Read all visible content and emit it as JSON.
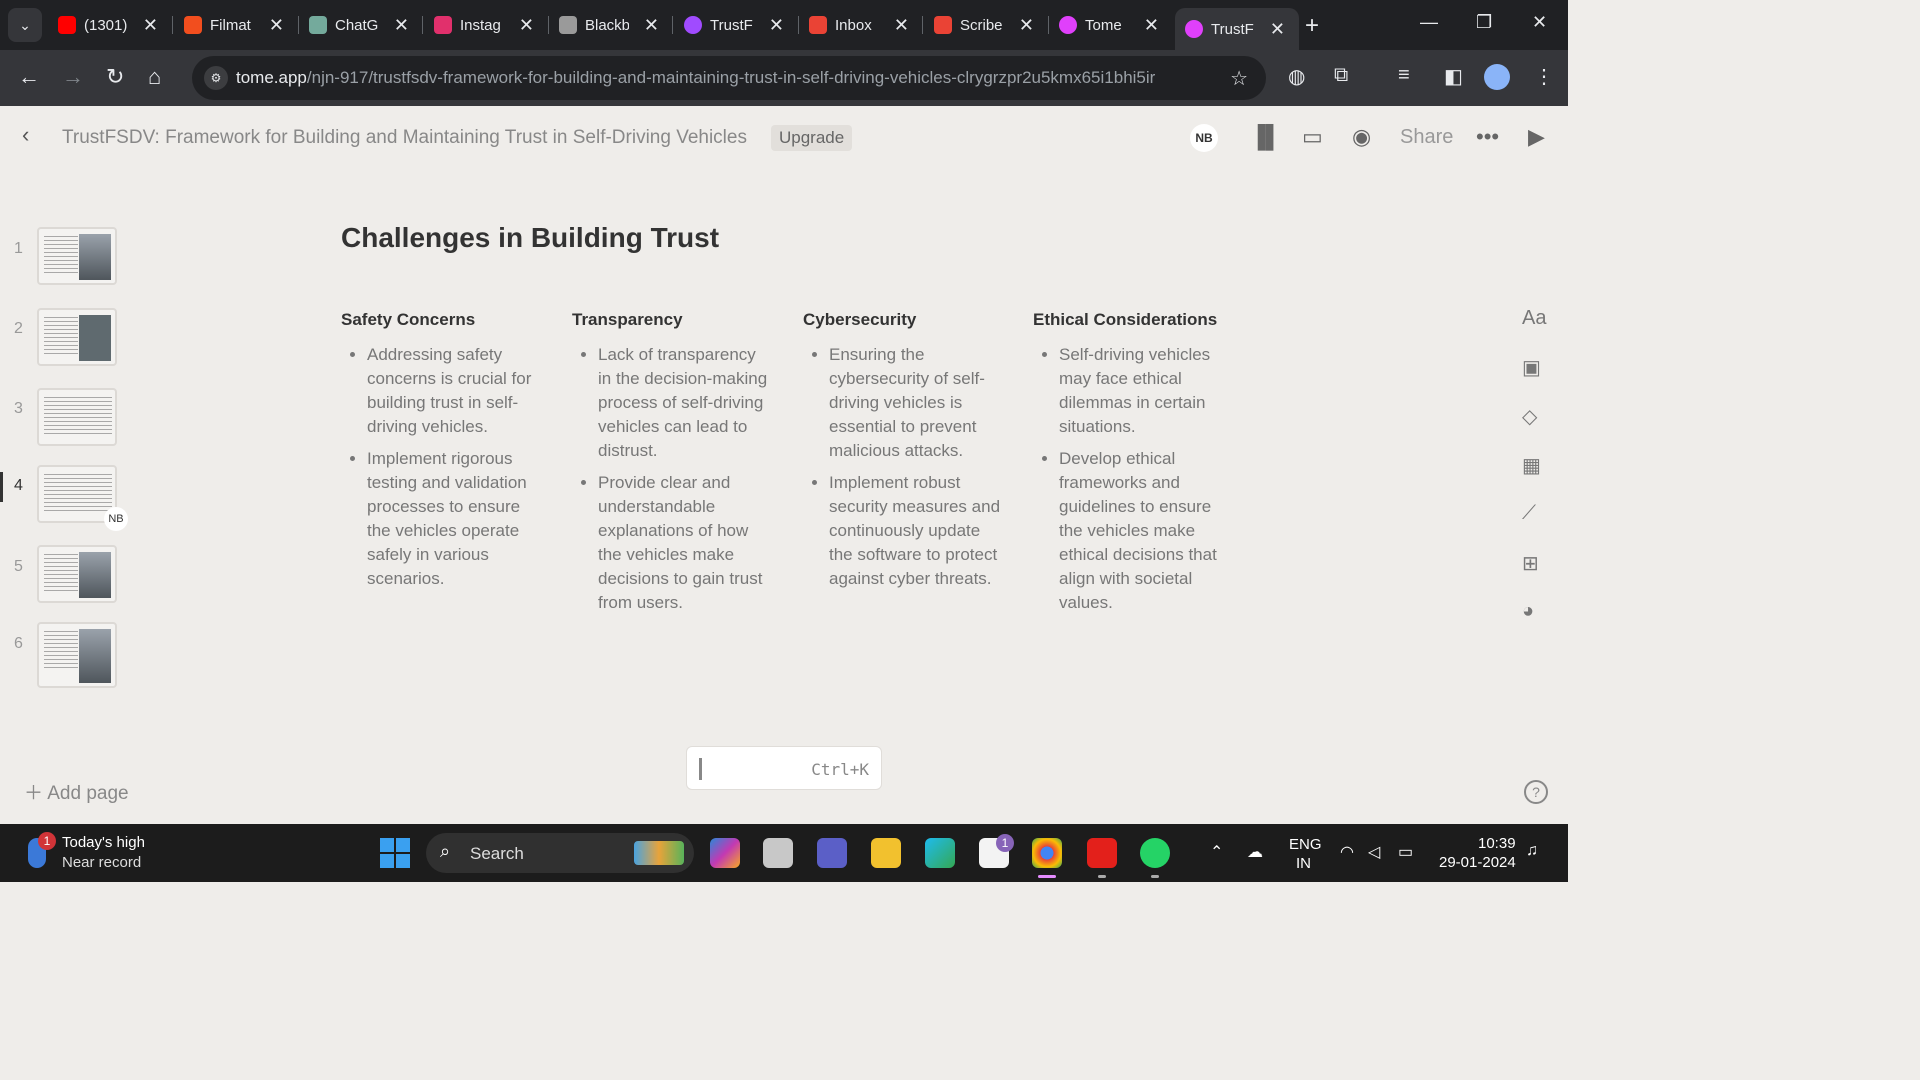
{
  "browser": {
    "tabs": [
      {
        "title": "(1301)",
        "icon": "youtube-icon",
        "color": "#ff0000"
      },
      {
        "title": "Filmat",
        "icon": "figma-icon",
        "color": "#f24e1e"
      },
      {
        "title": "ChatG",
        "icon": "chatgpt-icon",
        "color": "#74aa9c"
      },
      {
        "title": "Instag",
        "icon": "instagram-icon",
        "color": "#e1306c"
      },
      {
        "title": "Blackb",
        "icon": "blackbox-icon",
        "color": "#9a9a9a"
      },
      {
        "title": "TrustF",
        "icon": "gemini-icon",
        "color": "#a04bff"
      },
      {
        "title": "Inbox",
        "icon": "gmail-icon",
        "color": "#ea4335"
      },
      {
        "title": "Scribe",
        "icon": "gmail-icon",
        "color": "#ea4335"
      },
      {
        "title": "Tome",
        "icon": "tome-icon",
        "color": "#e040fb"
      },
      {
        "title": "TrustF",
        "icon": "tome-icon",
        "color": "#e040fb"
      }
    ],
    "url_host": "tome.app",
    "url_path": "/njn-917/trustfsdv-framework-for-building-and-maintaining-trust-in-self-driving-vehicles-clrygrzpr2u5kmx65i1bhi5ir"
  },
  "header": {
    "title": "TrustFSDV: Framework for Building and Maintaining Trust in Self-Driving Vehicles",
    "upgrade_label": "Upgrade",
    "avatar_initials": "NB",
    "share_label": "Share"
  },
  "sidebar": {
    "pages": [
      "1",
      "2",
      "3",
      "4",
      "5",
      "6"
    ],
    "active_page": "4",
    "badge": "NB",
    "add_page_label": "Add page"
  },
  "slide": {
    "title": "Challenges in Building Trust",
    "columns": [
      {
        "heading": "Safety Concerns",
        "bullets": [
          "Addressing safety concerns is crucial for building trust in self-driving vehicles.",
          "Implement rigorous testing and validation processes to ensure the vehicles operate safely in various scenarios."
        ]
      },
      {
        "heading": "Transparency",
        "bullets": [
          "Lack of transparency in the decision-making process of self-driving vehicles can lead to distrust.",
          "Provide clear and understandable explanations of how the vehicles make decisions to gain trust from users."
        ]
      },
      {
        "heading": "Cybersecurity",
        "bullets": [
          "Ensuring the cybersecurity of self-driving vehicles is essential to prevent malicious attacks.",
          "Implement robust security measures and continuously update the software to protect against cyber threats."
        ]
      },
      {
        "heading": "Ethical Considerations",
        "bullets": [
          "Self-driving vehicles may face ethical dilemmas in certain situations.",
          "Develop ethical frameworks and guidelines to ensure the vehicles make ethical decisions that align with societal values."
        ]
      }
    ]
  },
  "tools": {
    "text_label": "Aa",
    "command_shortcut": "Ctrl+K"
  },
  "taskbar": {
    "weather_line1": "Today's high",
    "weather_line2": "Near record",
    "weather_badge": "1",
    "search_label": "Search",
    "store_badge": "1",
    "lang_line1": "ENG",
    "lang_line2": "IN",
    "time": "10:39",
    "date": "29-01-2024"
  }
}
